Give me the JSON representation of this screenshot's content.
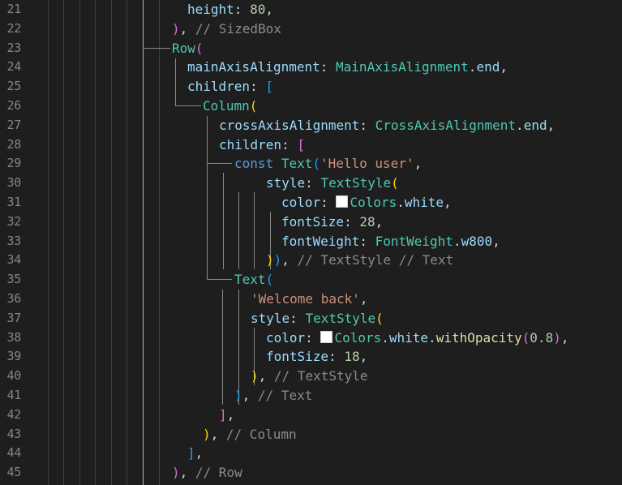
{
  "colors": {
    "background": "#1e1e1e",
    "line_number": "#858585",
    "identifier": "#9cdcfe",
    "class": "#4ec9b0",
    "keyword": "#569cd6",
    "string": "#ce9178",
    "number": "#b5cea8",
    "function": "#dcdcaa",
    "comment": "#8b8b8b",
    "punctuation": "#d4d4d4",
    "bracket_gold": "#ffd700",
    "bracket_orchid": "#da70d6",
    "bracket_blue": "#179fff",
    "swatch_white": "#ffffff"
  },
  "editor": {
    "line_numbers": [
      "21",
      "22",
      "23",
      "24",
      "25",
      "26",
      "27",
      "28",
      "29",
      "30",
      "31",
      "32",
      "33",
      "34",
      "35",
      "36",
      "37",
      "38",
      "39",
      "40",
      "41",
      "42",
      "43",
      "44",
      "45"
    ],
    "lines": [
      {
        "indent": 231,
        "tokens": [
          {
            "t": "height",
            "c": "identifier"
          },
          {
            "t": ": ",
            "c": "punctuation"
          },
          {
            "t": "80",
            "c": "number"
          },
          {
            "t": ",",
            "c": "punctuation"
          }
        ]
      },
      {
        "indent": 212,
        "tokens": [
          {
            "t": ")",
            "c": "bracket_orchid"
          },
          {
            "t": ", ",
            "c": "punctuation"
          },
          {
            "t": "// SizedBox",
            "c": "comment"
          }
        ]
      },
      {
        "indent": 212,
        "tokens": [
          {
            "t": "Row",
            "c": "class"
          },
          {
            "t": "(",
            "c": "bracket_orchid"
          }
        ]
      },
      {
        "indent": 231,
        "tokens": [
          {
            "t": "mainAxisAlignment",
            "c": "identifier"
          },
          {
            "t": ": ",
            "c": "punctuation"
          },
          {
            "t": "MainAxisAlignment",
            "c": "class"
          },
          {
            "t": ".",
            "c": "punctuation"
          },
          {
            "t": "end",
            "c": "identifier"
          },
          {
            "t": ",",
            "c": "punctuation"
          }
        ]
      },
      {
        "indent": 231,
        "tokens": [
          {
            "t": "children",
            "c": "identifier"
          },
          {
            "t": ": ",
            "c": "punctuation"
          },
          {
            "t": "[",
            "c": "bracket_blue"
          }
        ]
      },
      {
        "indent": 250,
        "tokens": [
          {
            "t": "Column",
            "c": "class"
          },
          {
            "t": "(",
            "c": "bracket_gold"
          }
        ]
      },
      {
        "indent": 270,
        "tokens": [
          {
            "t": "crossAxisAlignment",
            "c": "identifier"
          },
          {
            "t": ": ",
            "c": "punctuation"
          },
          {
            "t": "CrossAxisAlignment",
            "c": "class"
          },
          {
            "t": ".",
            "c": "punctuation"
          },
          {
            "t": "end",
            "c": "identifier"
          },
          {
            "t": ",",
            "c": "punctuation"
          }
        ]
      },
      {
        "indent": 270,
        "tokens": [
          {
            "t": "children",
            "c": "identifier"
          },
          {
            "t": ": ",
            "c": "punctuation"
          },
          {
            "t": "[",
            "c": "bracket_orchid"
          }
        ]
      },
      {
        "indent": 289,
        "tokens": [
          {
            "t": "const",
            "c": "keyword"
          },
          {
            "t": " ",
            "c": "punctuation"
          },
          {
            "t": "Text",
            "c": "class"
          },
          {
            "t": "(",
            "c": "bracket_blue"
          },
          {
            "t": "'Hello user'",
            "c": "string"
          },
          {
            "t": ",",
            "c": "punctuation"
          }
        ]
      },
      {
        "indent": 328,
        "tokens": [
          {
            "t": "style",
            "c": "identifier"
          },
          {
            "t": ": ",
            "c": "punctuation"
          },
          {
            "t": "TextStyle",
            "c": "class"
          },
          {
            "t": "(",
            "c": "bracket_gold"
          }
        ]
      },
      {
        "indent": 347,
        "tokens": [
          {
            "t": "color",
            "c": "identifier"
          },
          {
            "t": ": ",
            "c": "punctuation"
          },
          {
            "t": "",
            "c": "swatch"
          },
          {
            "t": "Colors",
            "c": "class"
          },
          {
            "t": ".",
            "c": "punctuation"
          },
          {
            "t": "white",
            "c": "identifier"
          },
          {
            "t": ",",
            "c": "punctuation"
          }
        ]
      },
      {
        "indent": 347,
        "tokens": [
          {
            "t": "fontSize",
            "c": "identifier"
          },
          {
            "t": ": ",
            "c": "punctuation"
          },
          {
            "t": "28",
            "c": "number"
          },
          {
            "t": ",",
            "c": "punctuation"
          }
        ]
      },
      {
        "indent": 347,
        "tokens": [
          {
            "t": "fontWeight",
            "c": "identifier"
          },
          {
            "t": ": ",
            "c": "punctuation"
          },
          {
            "t": "FontWeight",
            "c": "class"
          },
          {
            "t": ".",
            "c": "punctuation"
          },
          {
            "t": "w800",
            "c": "identifier"
          },
          {
            "t": ",",
            "c": "punctuation"
          }
        ]
      },
      {
        "indent": 328,
        "tokens": [
          {
            "t": ")",
            "c": "bracket_gold"
          },
          {
            "t": ")",
            "c": "bracket_blue"
          },
          {
            "t": ", ",
            "c": "punctuation"
          },
          {
            "t": "// TextStyle // Text",
            "c": "comment"
          }
        ]
      },
      {
        "indent": 289,
        "tokens": [
          {
            "t": "Text",
            "c": "class"
          },
          {
            "t": "(",
            "c": "bracket_blue"
          }
        ]
      },
      {
        "indent": 309,
        "tokens": [
          {
            "t": "'Welcome back'",
            "c": "string"
          },
          {
            "t": ",",
            "c": "punctuation"
          }
        ]
      },
      {
        "indent": 309,
        "tokens": [
          {
            "t": "style",
            "c": "identifier"
          },
          {
            "t": ": ",
            "c": "punctuation"
          },
          {
            "t": "TextStyle",
            "c": "class"
          },
          {
            "t": "(",
            "c": "bracket_gold"
          }
        ]
      },
      {
        "indent": 328,
        "tokens": [
          {
            "t": "color",
            "c": "identifier"
          },
          {
            "t": ": ",
            "c": "punctuation"
          },
          {
            "t": "",
            "c": "swatch"
          },
          {
            "t": "Colors",
            "c": "class"
          },
          {
            "t": ".",
            "c": "punctuation"
          },
          {
            "t": "white",
            "c": "identifier"
          },
          {
            "t": ".",
            "c": "punctuation"
          },
          {
            "t": "withOpacity",
            "c": "function"
          },
          {
            "t": "(",
            "c": "bracket_orchid"
          },
          {
            "t": "0.8",
            "c": "number"
          },
          {
            "t": ")",
            "c": "bracket_orchid"
          },
          {
            "t": ",",
            "c": "punctuation"
          }
        ]
      },
      {
        "indent": 328,
        "tokens": [
          {
            "t": "fontSize",
            "c": "identifier"
          },
          {
            "t": ": ",
            "c": "punctuation"
          },
          {
            "t": "18",
            "c": "number"
          },
          {
            "t": ",",
            "c": "punctuation"
          }
        ]
      },
      {
        "indent": 309,
        "tokens": [
          {
            "t": ")",
            "c": "bracket_gold"
          },
          {
            "t": ", ",
            "c": "punctuation"
          },
          {
            "t": "// TextStyle",
            "c": "comment"
          }
        ]
      },
      {
        "indent": 289,
        "tokens": [
          {
            "t": ")",
            "c": "bracket_blue"
          },
          {
            "t": ", ",
            "c": "punctuation"
          },
          {
            "t": "// Text",
            "c": "comment"
          }
        ]
      },
      {
        "indent": 270,
        "tokens": [
          {
            "t": "]",
            "c": "bracket_orchid"
          },
          {
            "t": ",",
            "c": "punctuation"
          }
        ]
      },
      {
        "indent": 250,
        "tokens": [
          {
            "t": ")",
            "c": "bracket_gold"
          },
          {
            "t": ", ",
            "c": "punctuation"
          },
          {
            "t": "// Column",
            "c": "comment"
          }
        ]
      },
      {
        "indent": 231,
        "tokens": [
          {
            "t": "]",
            "c": "bracket_blue"
          },
          {
            "t": ",",
            "c": "punctuation"
          }
        ]
      },
      {
        "indent": 212,
        "tokens": [
          {
            "t": ")",
            "c": "bracket_orchid"
          },
          {
            "t": ", ",
            "c": "punctuation"
          },
          {
            "t": "// Row",
            "c": "comment"
          }
        ]
      }
    ]
  }
}
